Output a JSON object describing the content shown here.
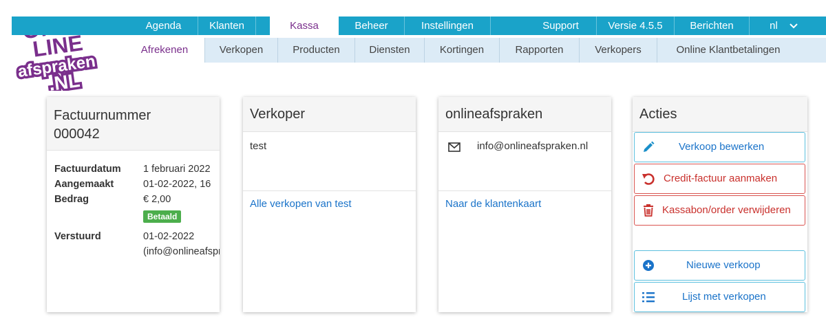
{
  "logo": {
    "line1": "ON",
    "line2": "LINE",
    "line3": "afspraken",
    "line4": ".NL"
  },
  "colors": {
    "nav": "#1aa3c9",
    "subnav": "#dcebf6",
    "active_text": "#7a2f8c",
    "link": "#1a73c9",
    "success": "#4cae4c",
    "danger": "#c9302c"
  },
  "top_nav": {
    "items": [
      "Agenda",
      "Klanten",
      "Kassa",
      "Beheer",
      "Instellingen",
      "Support",
      "Versie 4.5.5",
      "Berichten",
      "nl"
    ],
    "active": "Kassa",
    "dropdown_icon": "chevron-down-icon"
  },
  "sub_nav": {
    "items": [
      "Afrekenen",
      "Verkopen",
      "Producten",
      "Diensten",
      "Kortingen",
      "Rapporten",
      "Verkopers",
      "Online Klantbetalingen"
    ],
    "active": "Afrekenen"
  },
  "invoice": {
    "title_line1": "Factuurnummer",
    "title_line2": "000042",
    "rows": [
      {
        "label": "Factuurdatum",
        "value": "1 februari 2022"
      },
      {
        "label": "Aangemaakt",
        "value": "01-02-2022, 16"
      },
      {
        "label": "Bedrag",
        "value": "€ 2,00"
      },
      {
        "label": "Verstuurd",
        "value": "01-02-2022"
      }
    ],
    "status_badge": "Betaald",
    "sent_to": "(info@onlineafspraken.nl)"
  },
  "seller": {
    "title": "Verkoper",
    "name": "test",
    "link": "Alle verkopen van test"
  },
  "customer": {
    "title": "onlineafspraken",
    "email": "info@onlineafspraken.nl",
    "email_icon": "envelope-icon",
    "link": "Naar de klantenkaart"
  },
  "actions": {
    "title": "Acties",
    "buttons": [
      {
        "label": "Verkoop bewerken",
        "icon": "pencil-icon"
      },
      {
        "label": "Credit-factuur aanmaken",
        "icon": "undo-icon"
      },
      {
        "label": "Kassabon/order verwijderen",
        "icon": "trash-icon"
      },
      {
        "label": "Nieuwe verkoop",
        "icon": "plus-circle-icon"
      },
      {
        "label": "Lijst met verkopen",
        "icon": "list-icon"
      }
    ]
  }
}
